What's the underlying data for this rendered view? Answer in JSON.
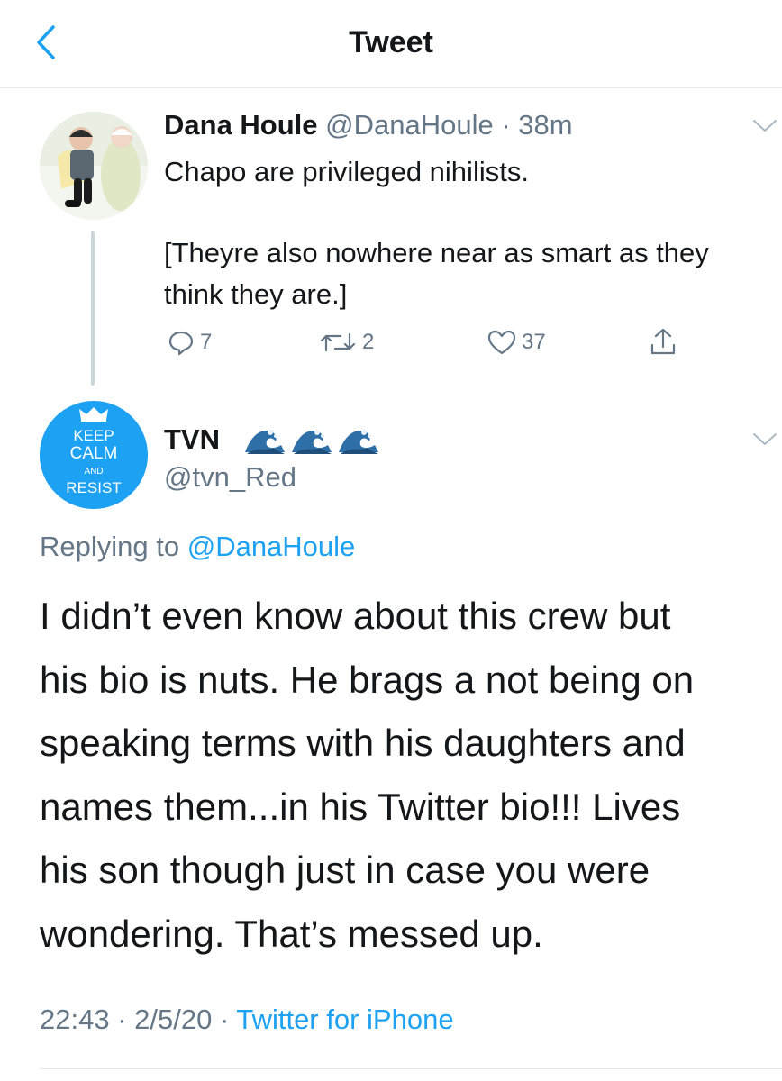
{
  "header": {
    "title": "Tweet"
  },
  "tweet1": {
    "name": "Dana Houle",
    "handle": "@DanaHoule",
    "sep": " · ",
    "time": "38m",
    "text_line1": "Chapo are privileged nihilists.",
    "text_line2": "[Theyre also nowhere near as smart as they think they are.]",
    "replies": "7",
    "retweets": "2",
    "likes": "37"
  },
  "tweet2": {
    "avatar_text": {
      "l1": "KEEP",
      "l2": "CALM",
      "l3": "AND",
      "l4": "RESIST"
    },
    "name": "TVN",
    "name_emojis": [
      "water-wave-icon",
      "water-wave-icon",
      "water-wave-icon"
    ],
    "handle": "@tvn_Red",
    "replying_prefix": "Replying to",
    "replying_handle": "@DanaHoule",
    "body": "I didn’t even know about this crew but\nhis bio is nuts. He brags a not being on\nspeaking terms with his daughters and\nnames them...in his Twitter bio!!! Lives\nhis son though just in case you were\nwondering. That’s messed up.",
    "time": "22:43",
    "date": "2/5/20",
    "sep": " · ",
    "source": "Twitter for iPhone"
  },
  "colors": {
    "accent": "#1da1f2",
    "muted": "#657786",
    "text": "#14171a",
    "divider": "#e1e8ed"
  }
}
